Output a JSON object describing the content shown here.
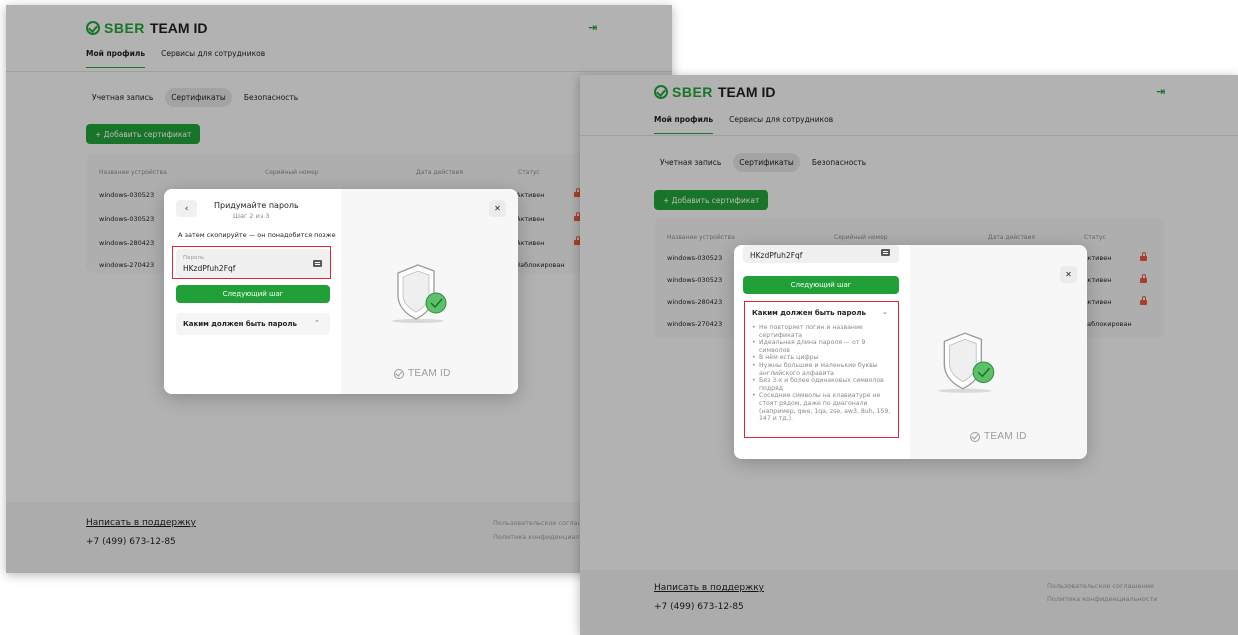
{
  "app": {
    "logo_brand": "SBER",
    "logo_product": "TEAM ID",
    "logout_icon": "logout-icon"
  },
  "nav": {
    "tabs": [
      "Мой профиль",
      "Сервисы для сотрудников"
    ],
    "subtabs": [
      "Учетная запись",
      "Сертификаты",
      "Безопасность"
    ]
  },
  "actions": {
    "add_certificate": "+ Добавить сертификат"
  },
  "table": {
    "headers": [
      "Название устройства",
      "Серийный номер",
      "Дата действия",
      "Статус"
    ],
    "rows": [
      {
        "device": "windows-030523",
        "status": "Активен"
      },
      {
        "device": "windows-030523",
        "status": "Активен"
      },
      {
        "device": "windows-280423",
        "status": "Активен"
      },
      {
        "device": "windows-270423",
        "status": "Заблокирован"
      }
    ]
  },
  "footer": {
    "support": "Написать в поддержку",
    "phone": "+7 (499) 673-12-85",
    "agreement": "Пользовательское соглашение",
    "privacy": "Политика конфиденциальности",
    "agreement_clipped": "Пользовательское соглашен",
    "privacy_clipped": "Политика конфиденциальн"
  },
  "modal": {
    "title": "Придумайте пароль",
    "step": "Шаг 2 из 3",
    "hint": "А затем скопируйте — он понадобится позже",
    "password_label": "Пароль",
    "password_value": "HKzdPfuh2Fqf",
    "next_button": "Следующий шаг",
    "accordion_title": "Каким должен быть пароль",
    "rules": [
      "Не повторяет логин и название сертификата",
      "Идеальная длина пароля — от 9 символов",
      "В нём есть цифры",
      "Нужны большие и маленькие буквы английского алфавита",
      "Без 3-х и более одинаковых символов подряд",
      "Соседние символы на клавиатуре не стоят рядом, даже по диагонали (например, qwe, 1qa, zse, aw3, 8uh, 159, 147 и тд.)."
    ],
    "brand": "TEAM ID",
    "back_icon": "back-arrow-icon",
    "close_icon": "close-icon"
  },
  "colors": {
    "brand_green": "#21a038",
    "highlight_red": "#d7263d",
    "lock_orange": "#e8573b"
  }
}
